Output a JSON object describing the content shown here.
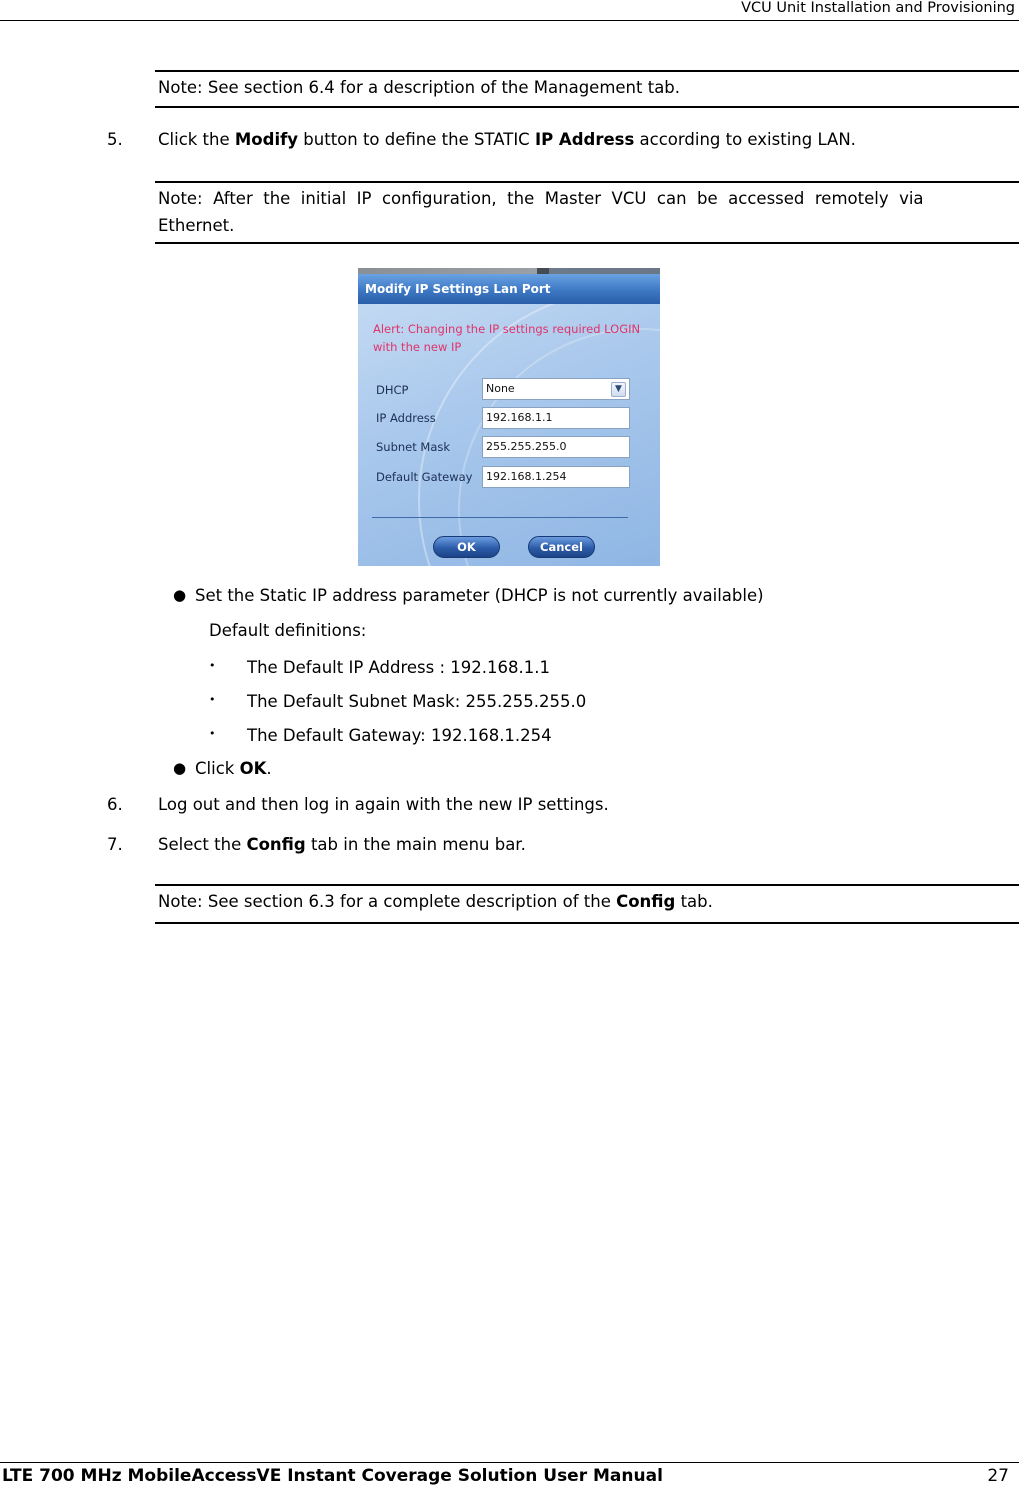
{
  "header": {
    "title": "VCU Unit Installation and Provisioning"
  },
  "notes": {
    "management": "Note: See section 6.4 for a description of the Management tab.",
    "after_ip_a": "Note:  After  the  initial  IP  configuration,  the  Master  VCU  can  be  accessed  remotely  via",
    "after_ip_b": "Ethernet.",
    "config_pre": "Note: See section 6.3 for a complete description of the ",
    "config_bold": "Config",
    "config_post": " tab."
  },
  "steps": {
    "s5": {
      "num": "5.",
      "pre": "Click the ",
      "b1": "Modify",
      "mid": " button to define the STATIC ",
      "b2": "IP Address",
      "post": " according to existing LAN."
    },
    "s6": {
      "num": "6.",
      "text": "Log out and then log in again with the new IP settings."
    },
    "s7": {
      "num": "7.",
      "pre": "Select the ",
      "b1": "Config",
      "post": " tab in the main menu bar."
    }
  },
  "bullets": {
    "static": "Set the Static IP address parameter (DHCP is not currently available)",
    "defaults_label": "Default definitions:",
    "defaults": [
      "The Default IP Address : 192.168.1.1",
      "The Default Subnet Mask: 255.255.255.0",
      "The Default Gateway: 192.168.1.254"
    ],
    "click_pre": "Click ",
    "click_bold": "OK",
    "click_post": "."
  },
  "dialog": {
    "title": "Modify IP Settings Lan Port",
    "alert": "Alert: Changing the IP settings required LOGIN with the new IP",
    "fields": {
      "dhcp": {
        "label": "DHCP",
        "value": "None"
      },
      "ip": {
        "label": "IP Address",
        "value": "192.168.1.1"
      },
      "subnet": {
        "label": "Subnet Mask",
        "value": "255.255.255.0"
      },
      "gateway": {
        "label": "Default Gateway",
        "value": "192.168.1.254"
      }
    },
    "ok_label": "OK",
    "cancel_label": "Cancel",
    "alert_color": "#e0336a",
    "title_color": "#3d78c4"
  },
  "footer": {
    "title": "LTE 700 MHz MobileAccessVE Instant Coverage Solution User Manual",
    "page": "27"
  }
}
